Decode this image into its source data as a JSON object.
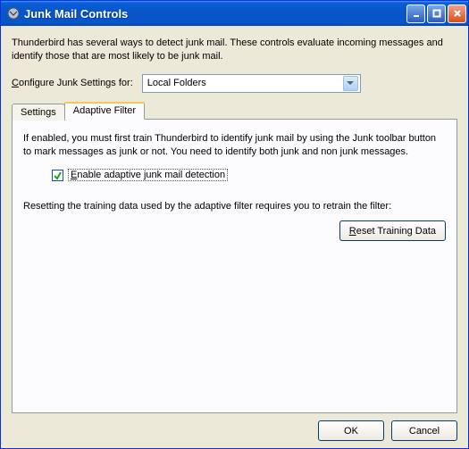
{
  "window": {
    "title": "Junk Mail Controls"
  },
  "description": "Thunderbird has several ways to detect junk mail. These controls evaluate incoming messages and identify those that are most likely to be junk mail.",
  "configure": {
    "label_pre": "C",
    "label_post": "onfigure Junk Settings for:",
    "selected": "Local Folders"
  },
  "tabs": {
    "settings": "Settings",
    "adaptive": "Adaptive Filter"
  },
  "adaptive_panel": {
    "description": "If enabled, you must first train Thunderbird to identify junk mail by using the Junk toolbar button to mark messages as junk or not. You need to identify both junk and non junk messages.",
    "enable_pre": "E",
    "enable_post": "nable adaptive junk mail detection",
    "reset_desc": "Resetting the training data used by the adaptive filter requires you to retrain the filter:",
    "reset_btn_pre": "R",
    "reset_btn_post": "eset Training Data"
  },
  "buttons": {
    "ok": "OK",
    "cancel": "Cancel"
  }
}
